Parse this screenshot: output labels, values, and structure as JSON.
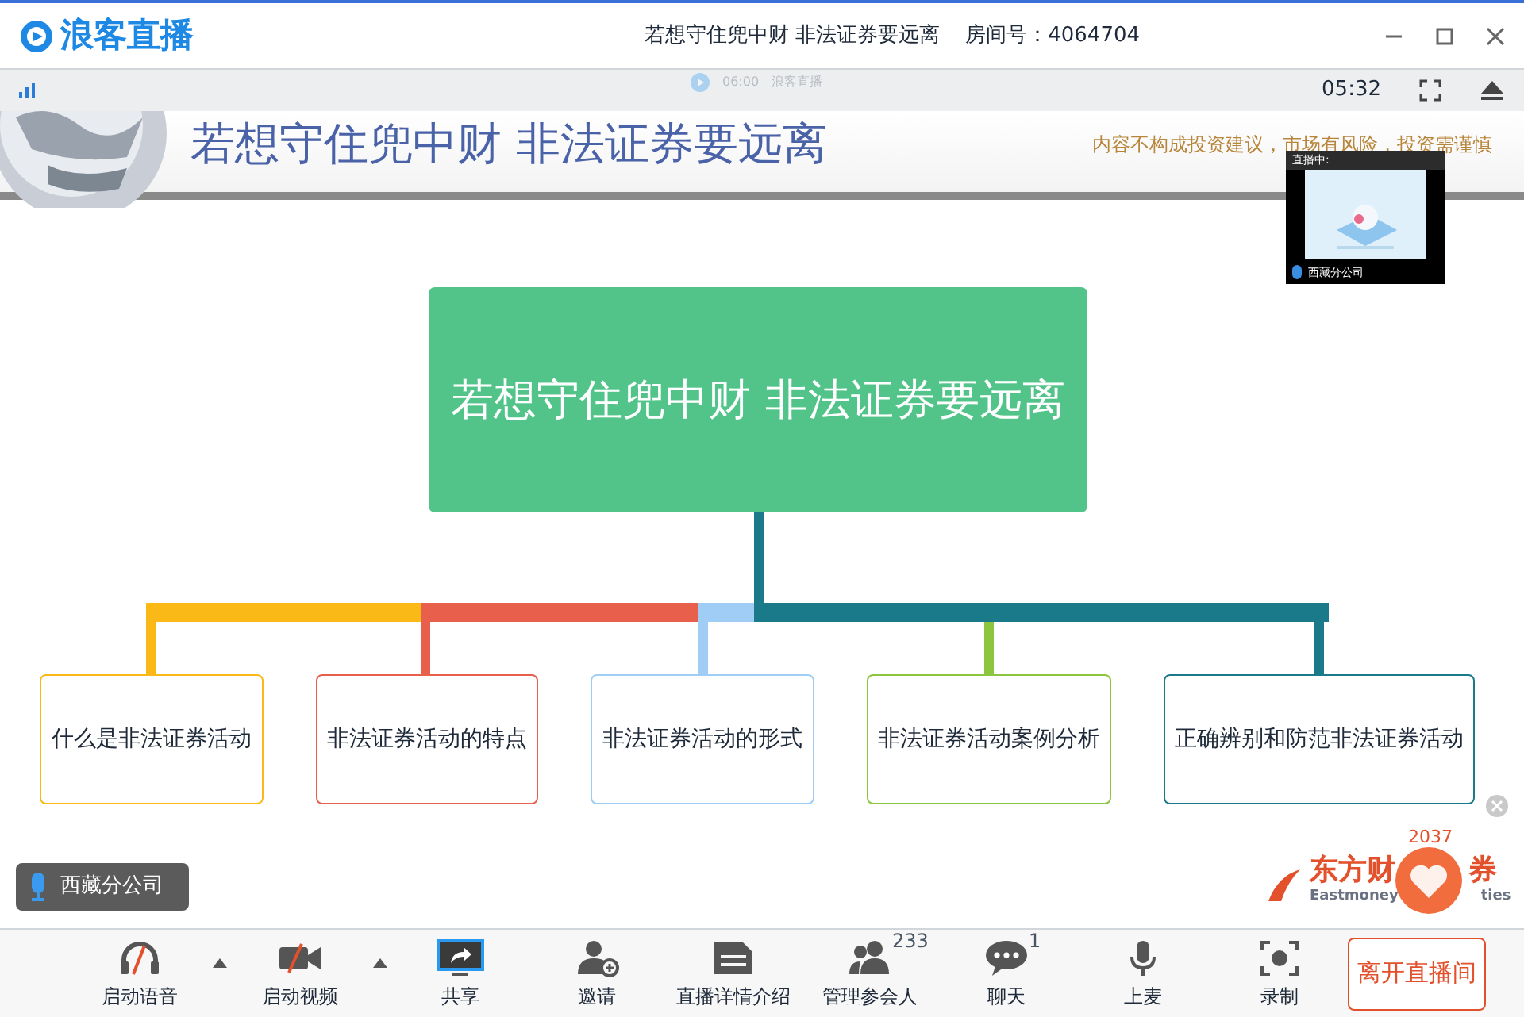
{
  "window": {
    "app_name": "浪客直播",
    "title": "若想守住兜中财 非法证券要远离",
    "room_label": "房间号：4064704"
  },
  "stream_bar": {
    "mini_time": "06:00",
    "mini_label": "浪客直播",
    "elapsed": "05:32"
  },
  "banner": {
    "title": "若想守住兜中财  非法证券要远离",
    "disclaimer": "内容不构成投资建议，市场有风险，投资需谨慎"
  },
  "preview": {
    "status": "直播中:",
    "name": "西藏分公司"
  },
  "mind_map": {
    "root": "若想守住兜中财  非法证券要远离",
    "children": [
      {
        "label": "什么是非法证券活动",
        "color": "#fbb917"
      },
      {
        "label": "非法证券活动的特点",
        "color": "#e8604c"
      },
      {
        "label": "非法证券活动的形式",
        "color": "#9fcdf5"
      },
      {
        "label": "非法证券活动案例分析",
        "color": "#8cc63f"
      },
      {
        "label": "正确辨别和防范非法证券活动",
        "color": "#1a7a8a"
      }
    ]
  },
  "speaker": {
    "name": "西藏分公司"
  },
  "sponsor": {
    "logo_left": "东方财",
    "logo_right": "券",
    "subtitle_left": "Eastmoney",
    "subtitle_right": "ties",
    "likes": "2037"
  },
  "toolbar": [
    {
      "label": "启动语音",
      "has_menu": true
    },
    {
      "label": "启动视频",
      "has_menu": true
    },
    {
      "label": "共享",
      "has_menu": false
    },
    {
      "label": "邀请",
      "has_menu": false
    },
    {
      "label": "直播详情介绍",
      "has_menu": false
    },
    {
      "label": "管理参会人",
      "has_menu": false,
      "badge": "233"
    },
    {
      "label": "聊天",
      "has_menu": false,
      "badge": "1"
    },
    {
      "label": "上麦",
      "has_menu": false
    },
    {
      "label": "录制",
      "has_menu": false
    }
  ],
  "leave_button": "离开直播间"
}
